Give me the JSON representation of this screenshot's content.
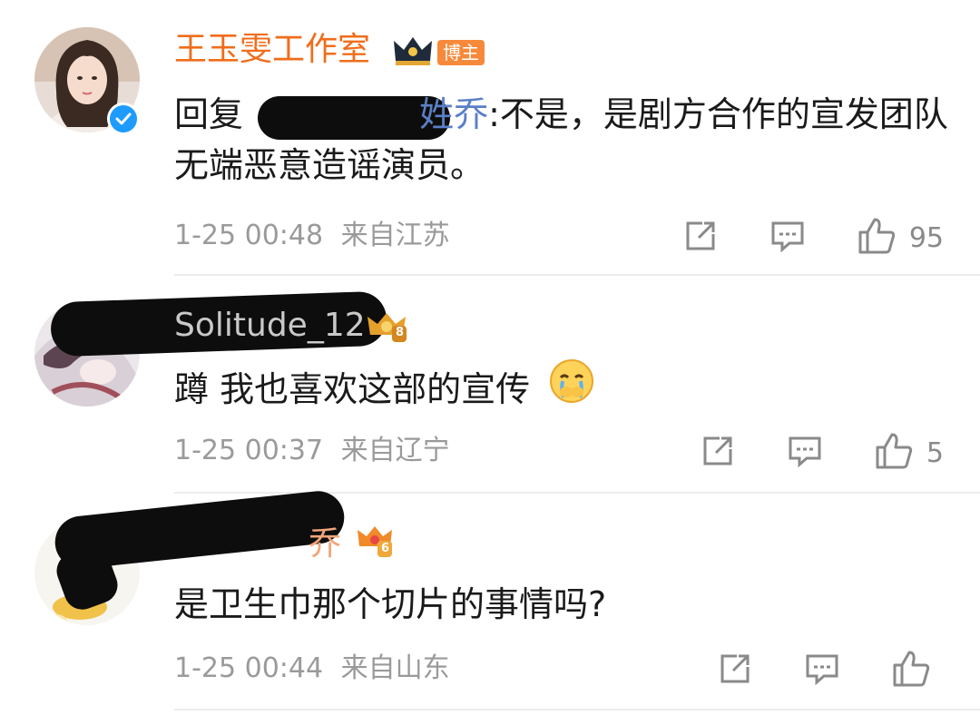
{
  "comments": [
    {
      "author": "王玉雯工作室",
      "host_badge": "博主",
      "reply_prefix": "回复",
      "mention_tail": "姓乔",
      "text": ":不是，是剧方合作的宣发团队无端恶意造谣演员。",
      "time": "1-25 00:48",
      "location": "来自江苏",
      "likes": "95",
      "verified": true
    },
    {
      "author": "Solitude_12",
      "level_badge": "8",
      "text": "蹲 我也喜欢这部的宣传",
      "time": "1-25 00:37",
      "location": "来自辽宁",
      "likes": "5"
    },
    {
      "author": "乔",
      "level_badge": "6",
      "text": "是卫生巾那个切片的事情吗?",
      "time": "1-25 00:44",
      "location": "来自山东",
      "likes": ""
    }
  ],
  "icons": {
    "share": "share-icon",
    "comment": "comment-icon",
    "like": "like-icon",
    "crown": "crown-icon"
  },
  "colors": {
    "author_name": "#f06d1b",
    "mention": "#5b7fc7",
    "meta_text": "#9a9a9a",
    "verified": "#1e9bff",
    "host_badge": "#f7893b"
  }
}
